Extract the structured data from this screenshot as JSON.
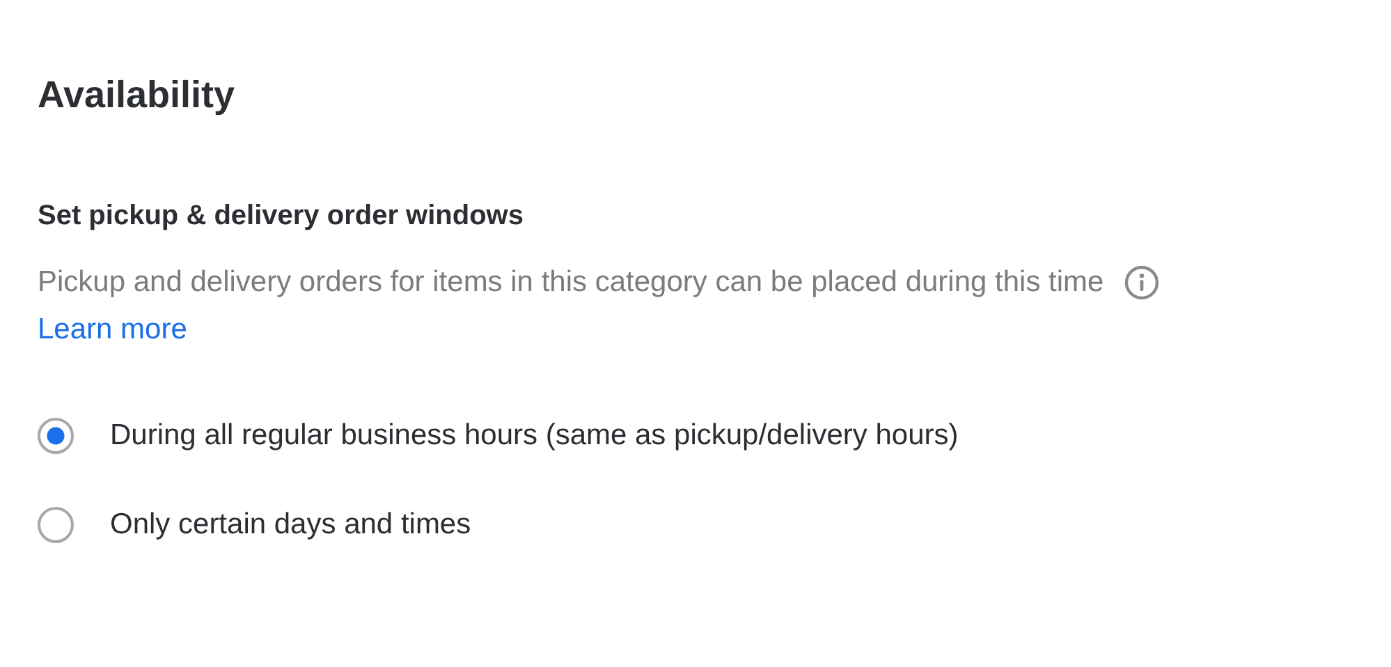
{
  "heading": "Availability",
  "section": {
    "title": "Set pickup & delivery order windows",
    "description": "Pickup and delivery orders for items in this category can be placed during this time",
    "link": "Learn more"
  },
  "options": [
    {
      "label": "During all regular business hours (same as pickup/delivery hours)",
      "selected": true
    },
    {
      "label": "Only certain days and times",
      "selected": false
    }
  ]
}
